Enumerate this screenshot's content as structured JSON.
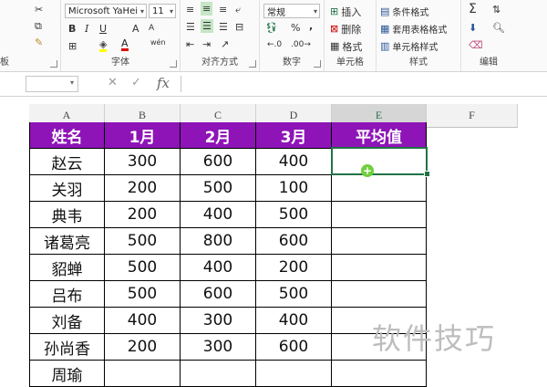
{
  "ribbon": {
    "clipboard": {
      "label": "板",
      "cut_icon": "scissors-icon",
      "format_painter_icon": "format-painter-icon"
    },
    "font": {
      "label": "字体",
      "font_name": "Microsoft YaHei",
      "font_size": "11",
      "bold": "B",
      "italic": "I",
      "underline": "U",
      "grow": "A",
      "shrink": "A",
      "font_color": "A",
      "wen": "wén"
    },
    "alignment": {
      "label": "对齐方式"
    },
    "number": {
      "label": "数字",
      "format": "常规",
      "percent": "%",
      "comma": ","
    },
    "cells": {
      "label": "单元格",
      "insert": "插入",
      "delete": "删除",
      "format": "格式"
    },
    "styles": {
      "label": "样式",
      "conditional": "条件格式",
      "table": "套用表格格式",
      "cell_style": "单元格样式"
    },
    "editing": {
      "label": "编辑",
      "sigma": "Σ"
    }
  },
  "formula_bar": {
    "fx": "fx",
    "cancel": "✕",
    "confirm": "✓"
  },
  "columns": [
    "A",
    "B",
    "C",
    "D",
    "E",
    "F"
  ],
  "table": {
    "headers": [
      "姓名",
      "1月",
      "2月",
      "3月",
      "平均值"
    ],
    "rows": [
      [
        "赵云",
        "300",
        "600",
        "400",
        ""
      ],
      [
        "关羽",
        "200",
        "500",
        "100",
        ""
      ],
      [
        "典韦",
        "200",
        "400",
        "500",
        ""
      ],
      [
        "诸葛亮",
        "500",
        "800",
        "600",
        ""
      ],
      [
        "貂蝉",
        "500",
        "400",
        "200",
        ""
      ],
      [
        "吕布",
        "500",
        "600",
        "500",
        ""
      ],
      [
        "刘备",
        "400",
        "300",
        "400",
        ""
      ],
      [
        "孙尚香",
        "200",
        "300",
        "600",
        ""
      ],
      [
        "周瑜",
        "",
        "",
        "",
        ""
      ]
    ]
  },
  "watermark": "软件技巧",
  "colors": {
    "header_fill": "#8e14b7",
    "selection": "#217346"
  }
}
